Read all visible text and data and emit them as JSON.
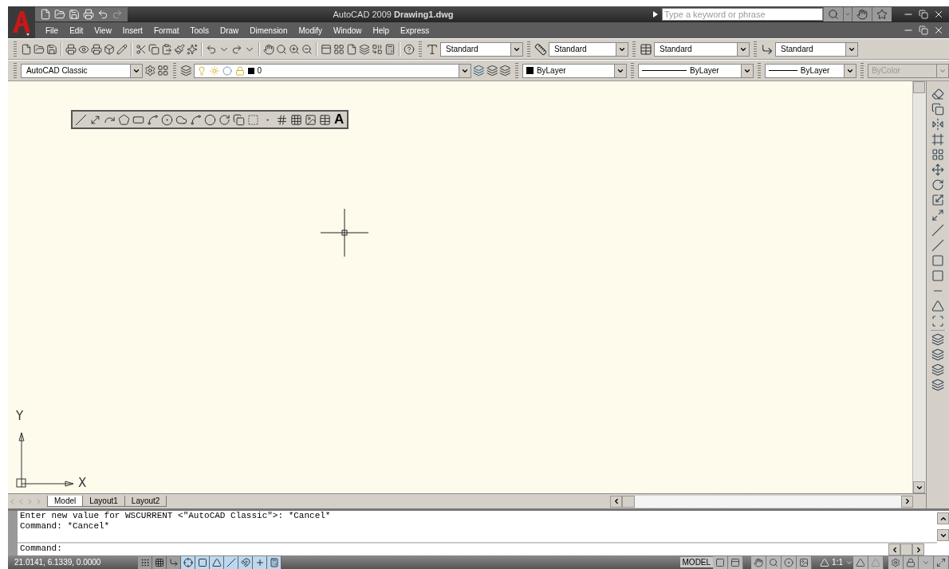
{
  "title_bar": {
    "app": "AutoCAD 2009",
    "document": "Drawing1.dwg",
    "search": {
      "placeholder": "Type a keyword or phrase"
    }
  },
  "menu": [
    {
      "label": "File"
    },
    {
      "label": "Edit"
    },
    {
      "label": "View"
    },
    {
      "label": "Insert"
    },
    {
      "label": "Format"
    },
    {
      "label": "Tools"
    },
    {
      "label": "Draw"
    },
    {
      "label": "Dimension"
    },
    {
      "label": "Modify"
    },
    {
      "label": "Window"
    },
    {
      "label": "Help"
    },
    {
      "label": "Express"
    }
  ],
  "style_dropdowns": [
    {
      "kind": "text",
      "value": "Standard"
    },
    {
      "kind": "dimension",
      "value": "Standard"
    },
    {
      "kind": "table",
      "value": "Standard"
    },
    {
      "kind": "multileader",
      "value": "Standard"
    }
  ],
  "workspace": {
    "value": "AutoCAD Classic"
  },
  "layer": {
    "value": "0"
  },
  "properties": [
    {
      "kind": "color",
      "value": "ByLayer",
      "disabled": false
    },
    {
      "kind": "linetype",
      "value": "ByLayer",
      "disabled": false
    },
    {
      "kind": "lineweight",
      "value": "ByLayer",
      "disabled": false
    },
    {
      "kind": "plotstyle",
      "value": "ByColor",
      "disabled": true
    }
  ],
  "draw_toolbar": {
    "text_tool": "A"
  },
  "ucs": {
    "x_label": "X",
    "y_label": "Y"
  },
  "layout_tabs": [
    {
      "label": "Model",
      "selected": true
    },
    {
      "label": "Layout1",
      "selected": false
    },
    {
      "label": "Layout2",
      "selected": false
    }
  ],
  "command_history": [
    "Enter new value for WSCURRENT <\"AutoCAD Classic\">: *Cancel*",
    "Command: *Cancel*"
  ],
  "command_prompt": "Command:",
  "status_bar": {
    "coordinates": "21.0141, 6.1339, 0.0000",
    "toggles": [
      {
        "kind": "snap",
        "on": false
      },
      {
        "kind": "grid",
        "on": false
      },
      {
        "kind": "ortho",
        "on": false
      },
      {
        "kind": "polar",
        "on": true
      },
      {
        "kind": "osnap",
        "on": true
      },
      {
        "kind": "otrack",
        "on": true
      },
      {
        "kind": "ducs",
        "on": true
      },
      {
        "kind": "dyn",
        "on": true
      },
      {
        "kind": "lwt",
        "on": true
      },
      {
        "kind": "qp",
        "on": true
      }
    ],
    "space": "MODEL",
    "annotation_scale": "1:1"
  }
}
